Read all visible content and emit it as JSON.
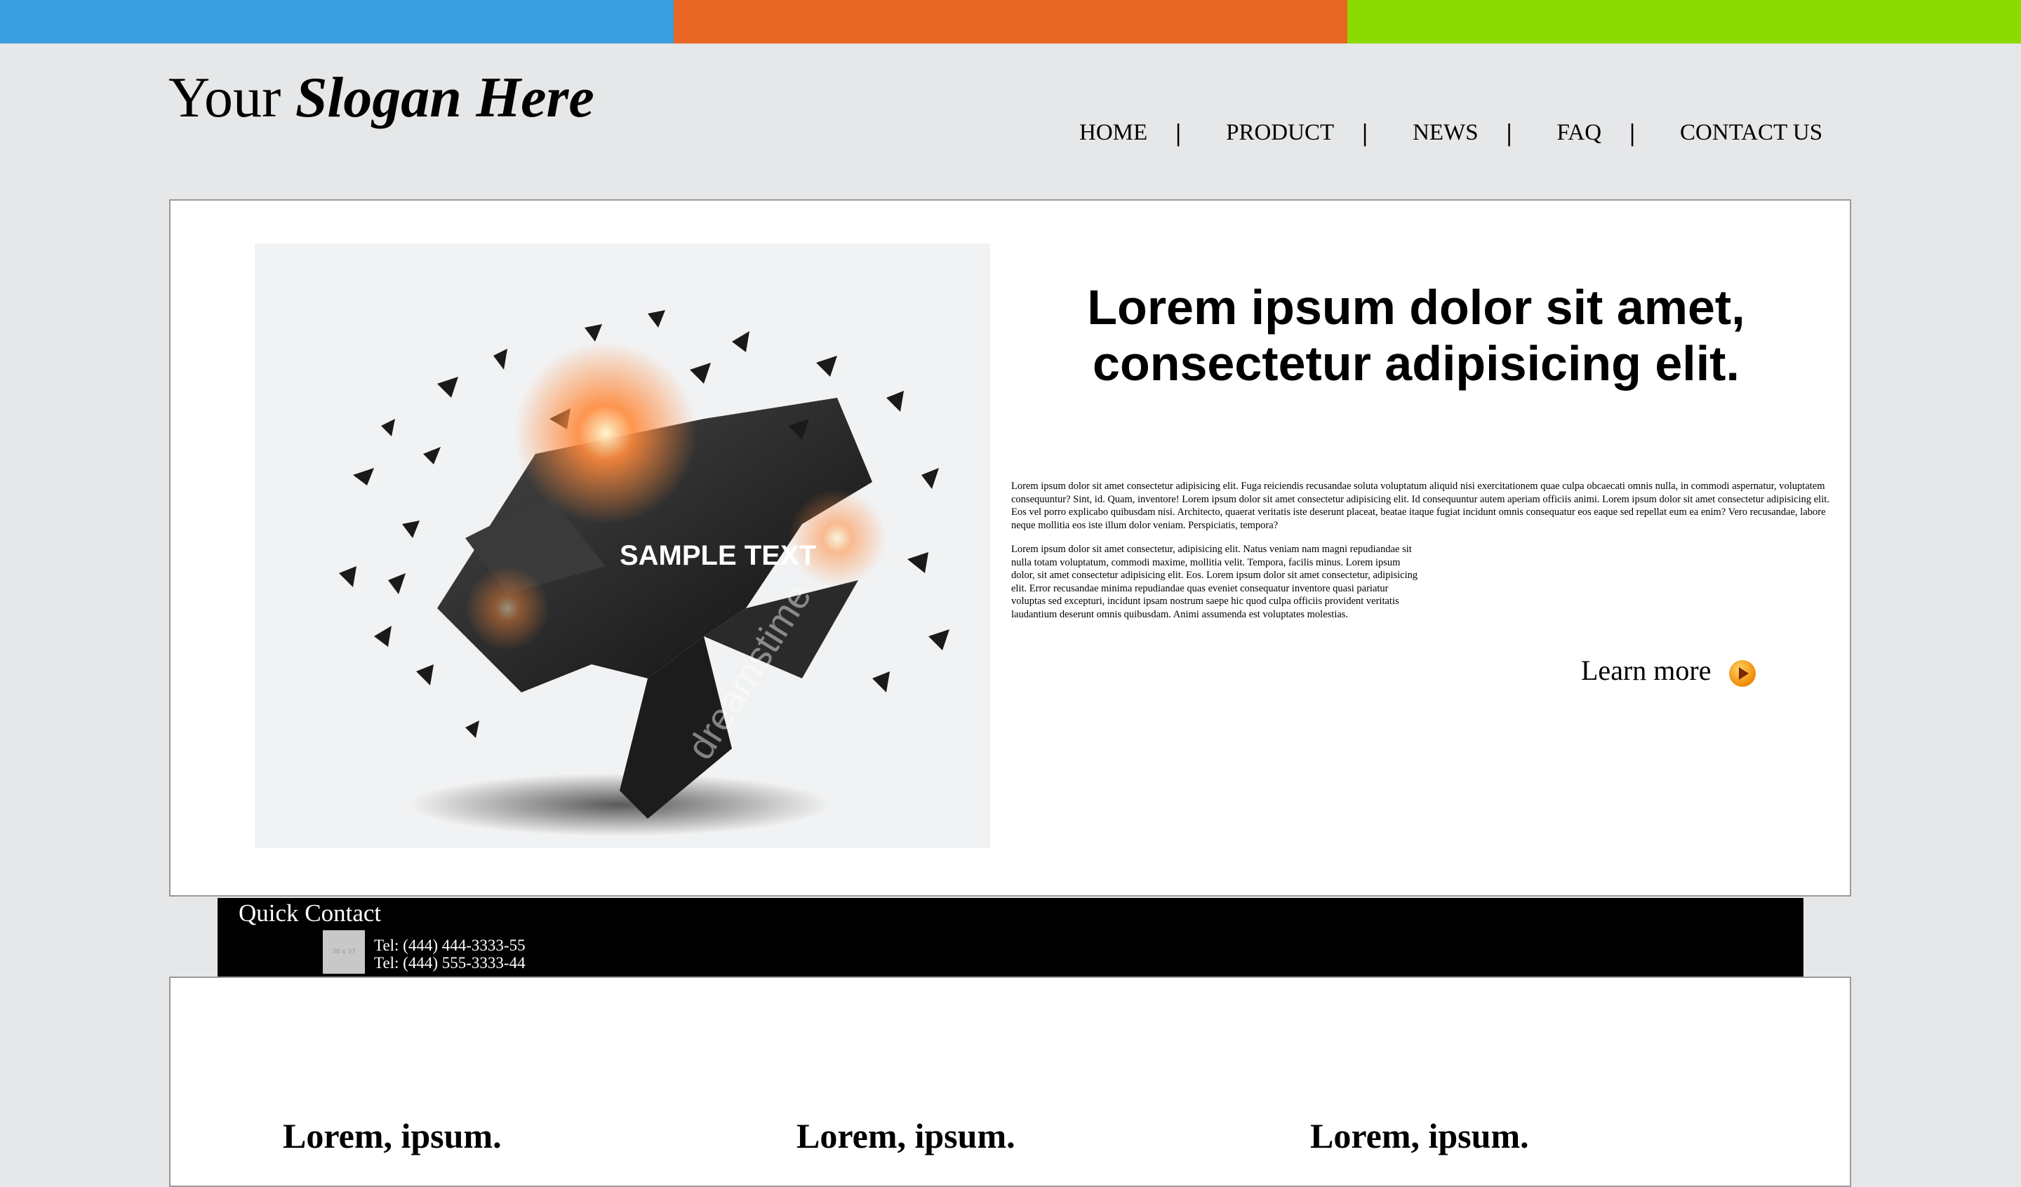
{
  "colors": {
    "bar_blue": "#3a9de0",
    "bar_orange": "#e86724",
    "bar_green": "#8bdb00",
    "page_bg": "#e6e7e8",
    "quick_contact_bg": "#000000"
  },
  "header": {
    "slogan_prefix": "Your",
    "slogan_emphasis": "Slogan Here"
  },
  "nav": {
    "items": [
      "HOME",
      "PRODUCT",
      "NEWS",
      "FAQ",
      "CONTACT US"
    ],
    "separator": "|"
  },
  "hero": {
    "image_icon": "abstract-shatter-image",
    "image_label": "SAMPLE TEXT",
    "watermark": "dreamstime",
    "title_line1": "Lorem ipsum dolor sit amet,",
    "title_line2": "consectetur adipisicing elit.",
    "paragraph1": "Lorem ipsum dolor sit amet consectetur adipisicing elit. Fuga reiciendis recusandae soluta voluptatum aliquid nisi exercitationem quae culpa obcaecati omnis nulla, in commodi aspernatur, voluptatem consequuntur? Sint, id. Quam, inventore! Lorem ipsum dolor sit amet consectetur adipisicing elit. Id consequuntur autem aperiam officiis animi. Lorem ipsum dolor sit amet consectetur adipisicing elit. Eos vel porro explicabo quibusdam nisi. Architecto, quaerat veritatis iste deserunt placeat, beatae itaque fugiat incidunt omnis consequatur eos eaque sed repellat eum ea enim? Vero recusandae, labore neque mollitia eos iste illum dolor veniam. Perspiciatis, tempora?",
    "paragraph2": "Lorem ipsum dolor sit amet consectetur, adipisicing elit. Natus veniam nam magni repudiandae sit nulla totam voluptatum, commodi maxime, mollitia velit. Tempora, facilis minus. Lorem ipsum dolor, sit amet consectetur adipisicing elit. Eos. Lorem ipsum dolor sit amet consectetur, adipisicing elit. Error recusandae minima repudiandae quas eveniet consequatur inventore quasi pariatur voluptas sed excepturi, incidunt ipsam nostrum saepe hic quod culpa officiis provident veritatis laudantium deserunt omnis quibusdam. Animi assumenda est voluptates molestias.",
    "learn_more": "Learn more",
    "learn_more_icon": "play-arrow-icon"
  },
  "quick_contact": {
    "title": "Quick Contact",
    "thumbnail_label": "38 x 37",
    "tel1": "Tel: (444) 444-3333-55",
    "tel2": "Tel: (444) 555-3333-44"
  },
  "columns": {
    "titles": [
      "Lorem, ipsum.",
      "Lorem, ipsum.",
      "Lorem, ipsum."
    ]
  }
}
